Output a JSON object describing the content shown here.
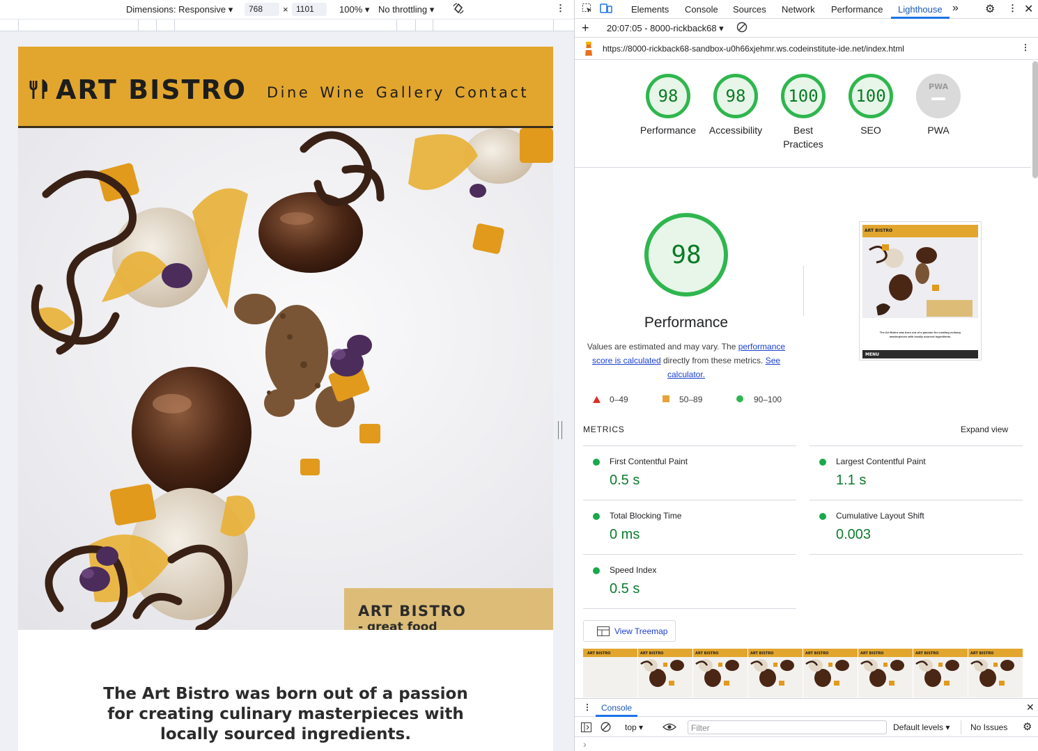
{
  "device_toolbar": {
    "dimensions_label": "Dimensions: Responsive",
    "width": "768",
    "times": "×",
    "height": "1101",
    "zoom": "100%",
    "throttling": "No throttling"
  },
  "site": {
    "logo": "ART BISTRO",
    "nav": [
      "Dine",
      "Wine",
      "Gallery",
      "Contact"
    ],
    "overlay_title": "ART BISTRO",
    "overlay_subtitle": "- great food\nIn the heart of Stockholm",
    "intro": "The Art Bistro was born out of a passion for creating culinary masterpieces with locally sourced ingredients."
  },
  "devtools": {
    "tabs": [
      "Elements",
      "Console",
      "Sources",
      "Network",
      "Performance",
      "Lighthouse"
    ],
    "active_tab": "Lighthouse",
    "more_tabs": "»",
    "report_selector": "20:07:05 - 8000-rickback68",
    "url": "https://8000-rickback68-sandbox-u0h66xjehmr.ws.codeinstitute-ide.net/index.html"
  },
  "lighthouse": {
    "gauges": [
      {
        "score": "98",
        "label": "Performance"
      },
      {
        "score": "98",
        "label": "Accessibility"
      },
      {
        "score": "100",
        "label": "Best\nPractices"
      },
      {
        "score": "100",
        "label": "SEO"
      },
      {
        "score": "",
        "label": "PWA"
      }
    ],
    "pwa_badge": "PWA",
    "main_score": "98",
    "main_label": "Performance",
    "desc_prefix": "Values are estimated and may vary. The ",
    "desc_link1": "performance score is calculated",
    "desc_middle": " directly from these metrics. ",
    "desc_link2": "See calculator.",
    "legend": [
      {
        "range": "0–49",
        "color": "#d93025"
      },
      {
        "range": "50–89",
        "color": "#e8a23a"
      },
      {
        "range": "90–100",
        "color": "#2fb64e"
      }
    ],
    "metrics_title": "METRICS",
    "expand_view": "Expand view",
    "metrics": [
      {
        "name": "First Contentful Paint",
        "value": "0.5 s"
      },
      {
        "name": "Largest Contentful Paint",
        "value": "1.1 s"
      },
      {
        "name": "Total Blocking Time",
        "value": "0 ms"
      },
      {
        "name": "Cumulative Layout Shift",
        "value": "0.003"
      },
      {
        "name": "Speed Index",
        "value": "0.5 s"
      }
    ],
    "view_treemap": "View Treemap",
    "screenshot_menu": "MENU",
    "screenshot_text": "The Art Bistro was born out of a passion for creating culinary masterpieces with locally sourced ingredients."
  },
  "console": {
    "title": "Console",
    "context": "top",
    "filter_placeholder": "Filter",
    "levels": "Default levels",
    "issues": "No Issues",
    "prompt": "›"
  },
  "colors": {
    "header": "#e2a62e",
    "overlay": "#dcbc77",
    "score_green": "#2fb64e",
    "link": "#1a3fd1"
  }
}
